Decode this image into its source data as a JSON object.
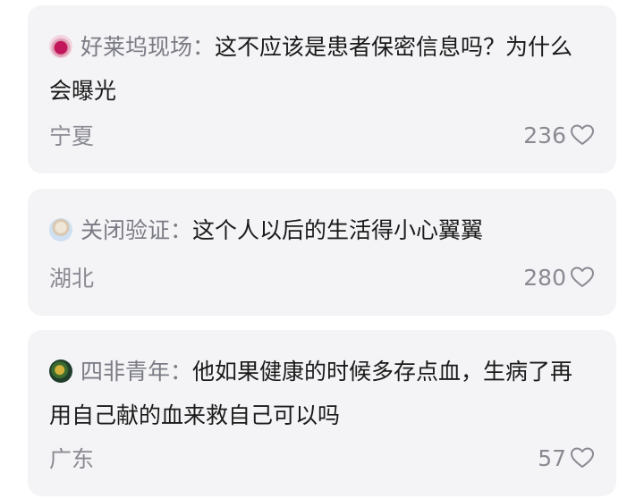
{
  "comments": [
    {
      "username": "好莱坞现场：",
      "text": "这不应该是患者保密信息吗？为什么会曝光",
      "location": "宁夏",
      "likes": "236",
      "avatar_icon": "avatar-icon"
    },
    {
      "username": "关闭验证：",
      "text": "这个人以后的生活得小心翼翼",
      "location": "湖北",
      "likes": "280",
      "avatar_icon": "avatar-icon"
    },
    {
      "username": "四非青年：",
      "text": "他如果健康的时候多存点血，生病了再用自己献的血来救自己可以吗",
      "location": "广东",
      "likes": "57",
      "avatar_icon": "avatar-icon"
    }
  ],
  "colors": {
    "card_bg": "#f4f4f6",
    "username": "#7b7b85",
    "text": "#1a1a1a",
    "meta": "#8a8a93"
  },
  "icons": {
    "like": "heart-outline-icon"
  }
}
